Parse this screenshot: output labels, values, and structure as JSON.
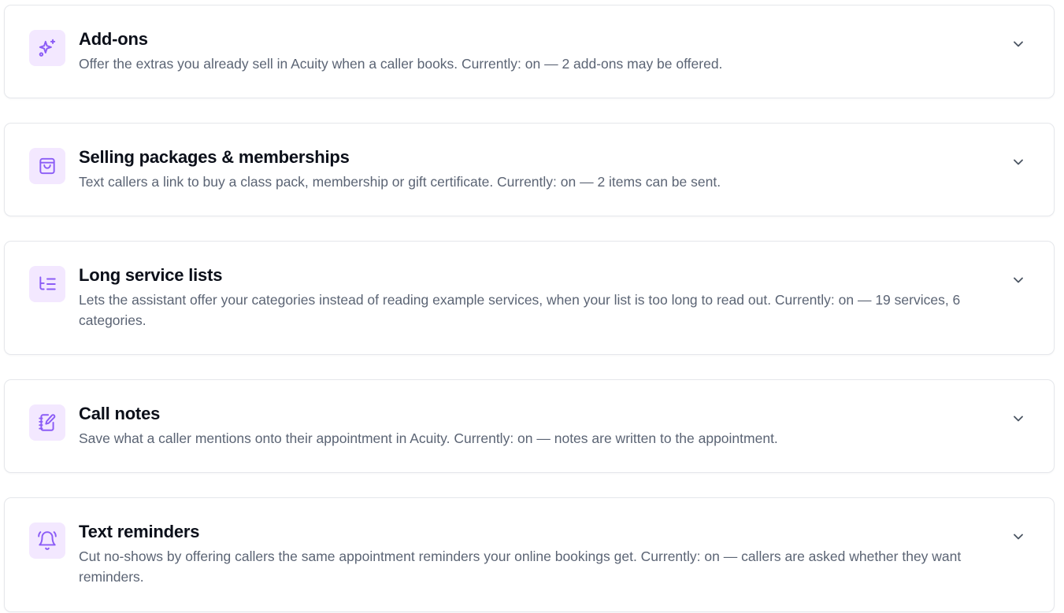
{
  "theme": {
    "icon_color": "#8b5cf6",
    "icon_tile_bg": "#f3e8ff",
    "title_color": "#0b0f19",
    "desc_color": "#5b6474",
    "border_color": "#e5e7eb"
  },
  "sections": [
    {
      "icon": "sparkles-icon",
      "title": "Add-ons",
      "description": "Offer the extras you already sell in Acuity when a caller books. Currently: on — 2 add-ons may be offered.",
      "expanded": false
    },
    {
      "icon": "shopping-bag-icon",
      "title": "Selling packages & memberships",
      "description": "Text callers a link to buy a class pack, membership or gift certificate. Currently: on — 2 items can be sent.",
      "expanded": false
    },
    {
      "icon": "list-tree-icon",
      "title": "Long service lists",
      "description": "Lets the assistant offer your categories instead of reading example services, when your list is too long to read out. Currently: on — 19 services, 6 categories.",
      "expanded": false
    },
    {
      "icon": "notebook-pen-icon",
      "title": "Call notes",
      "description": "Save what a caller mentions onto their appointment in Acuity. Currently: on — notes are written to the appointment.",
      "expanded": false
    },
    {
      "icon": "bell-ring-icon",
      "title": "Text reminders",
      "description": "Cut no-shows by offering callers the same appointment reminders your online bookings get. Currently: on — callers are asked whether they want reminders.",
      "expanded": false
    }
  ]
}
